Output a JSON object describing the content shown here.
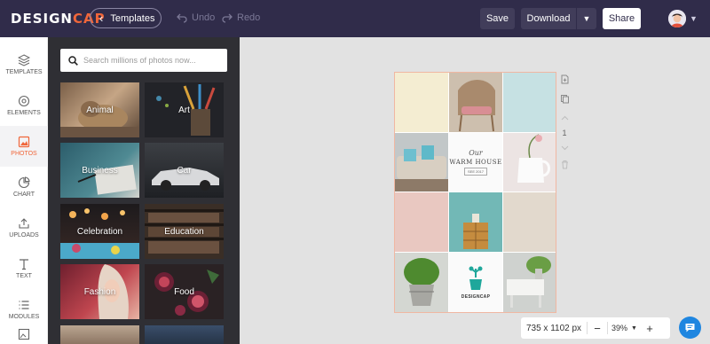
{
  "header": {
    "logo_main": "DESIGN",
    "logo_accent": "CAP",
    "templates_label": "Templates",
    "undo_label": "Undo",
    "redo_label": "Redo",
    "save_label": "Save",
    "download_label": "Download",
    "share_label": "Share"
  },
  "nav": {
    "items": [
      {
        "label": "TEMPLATES",
        "icon": "layers-icon"
      },
      {
        "label": "ELEMENTS",
        "icon": "elements-icon"
      },
      {
        "label": "PHOTOS",
        "icon": "photo-icon",
        "active": true
      },
      {
        "label": "CHART",
        "icon": "pie-chart-icon"
      },
      {
        "label": "UPLOADS",
        "icon": "upload-icon"
      },
      {
        "label": "TEXT",
        "icon": "text-icon"
      },
      {
        "label": "MODULES",
        "icon": "list-icon"
      }
    ]
  },
  "photos": {
    "search_placeholder": "Search millions of photos now...",
    "categories": [
      "Animal",
      "Art",
      "Business",
      "Car",
      "Celebration",
      "Education",
      "Fashion",
      "Food"
    ]
  },
  "canvas": {
    "card_line1": "Our",
    "card_line2": "WARM HOUSE",
    "card_line3": "SEE 2017",
    "brand_label": "DESIGNCAP",
    "page_number": "1"
  },
  "status": {
    "dimensions": "735 x 1102 px",
    "zoom": "39%",
    "zoom_out": "−",
    "zoom_in": "+"
  },
  "colors": {
    "topbar": "#302c4a",
    "accent": "#f0663a",
    "panel": "#2f2f34",
    "workspace": "#e2e2e2",
    "chat": "#1f86e0"
  }
}
